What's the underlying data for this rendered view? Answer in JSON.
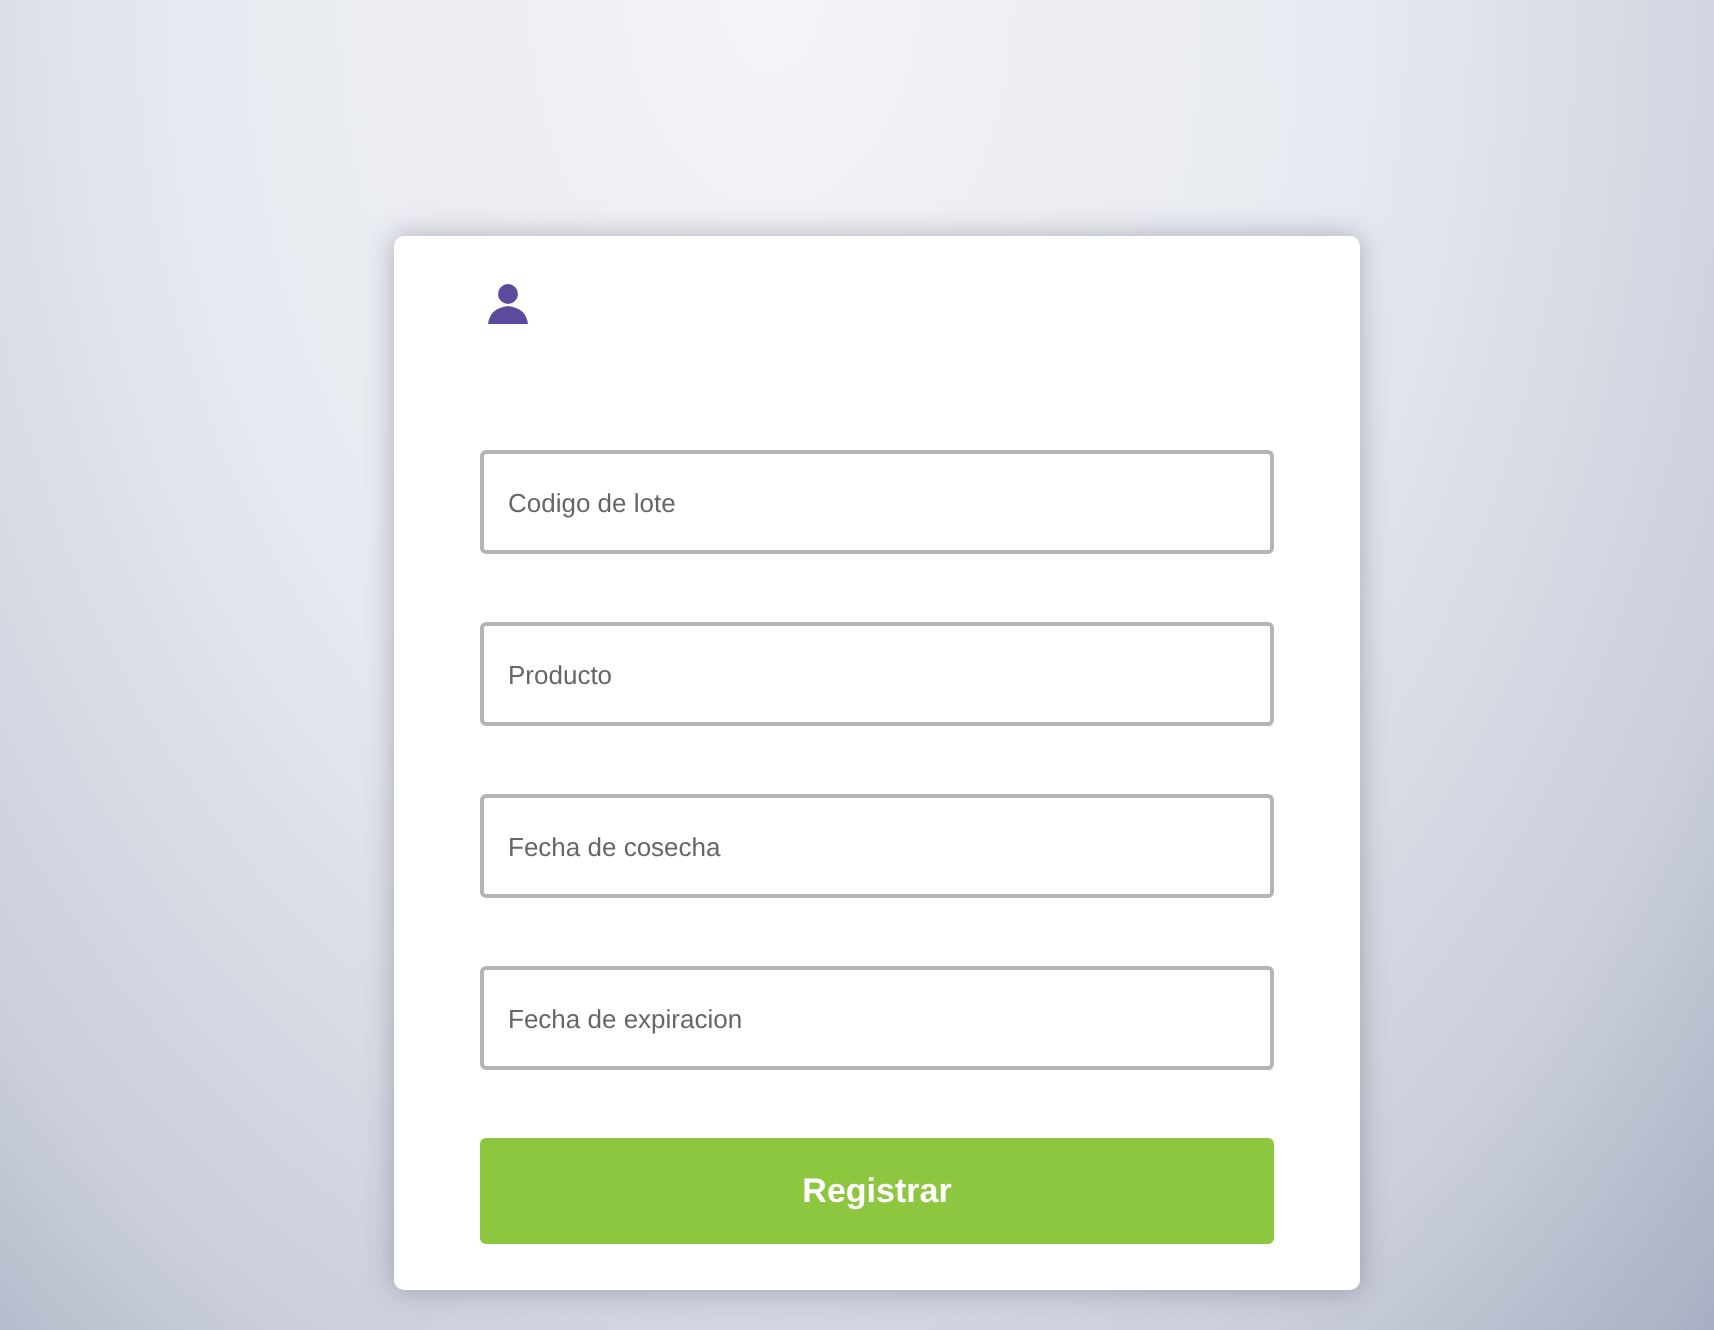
{
  "form": {
    "fields": [
      {
        "placeholder": "Codigo de lote"
      },
      {
        "placeholder": "Producto"
      },
      {
        "placeholder": "Fecha de cosecha"
      },
      {
        "placeholder": "Fecha de expiracion"
      }
    ],
    "submit": "Registrar"
  }
}
